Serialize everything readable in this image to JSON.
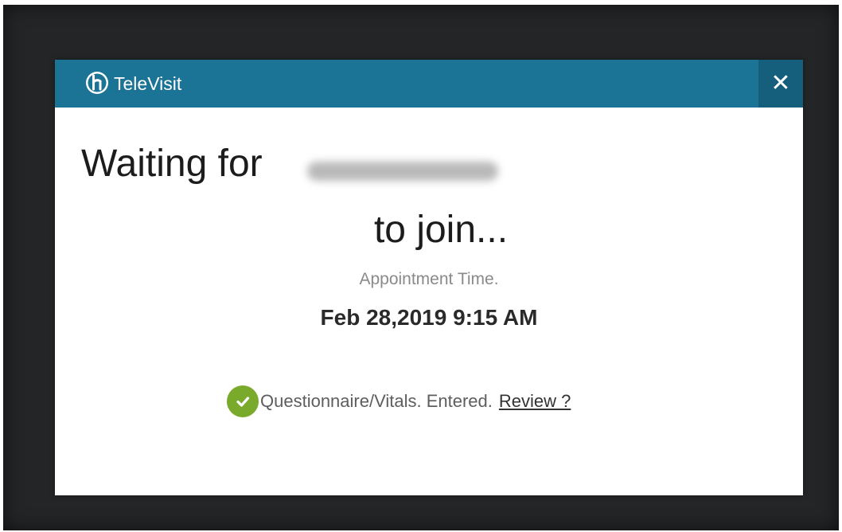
{
  "app": {
    "name": "TeleVisit",
    "close_label": "✕"
  },
  "main": {
    "waiting_prefix": "Waiting for",
    "provider_name": "",
    "join_text": "to join...",
    "appointment_label": "Appointment Time.",
    "appointment_time": "Feb 28,2019 9:15 AM"
  },
  "status": {
    "text": "Questionnaire/Vitals. Entered.",
    "review_label": "Review ?"
  },
  "colors": {
    "titlebar": "#1b7396",
    "close_bg": "#155f7c",
    "check": "#7aaa2c"
  },
  "icons": {
    "logo": "televisit-logo-icon",
    "close": "close-icon",
    "status": "check-circle-icon"
  }
}
